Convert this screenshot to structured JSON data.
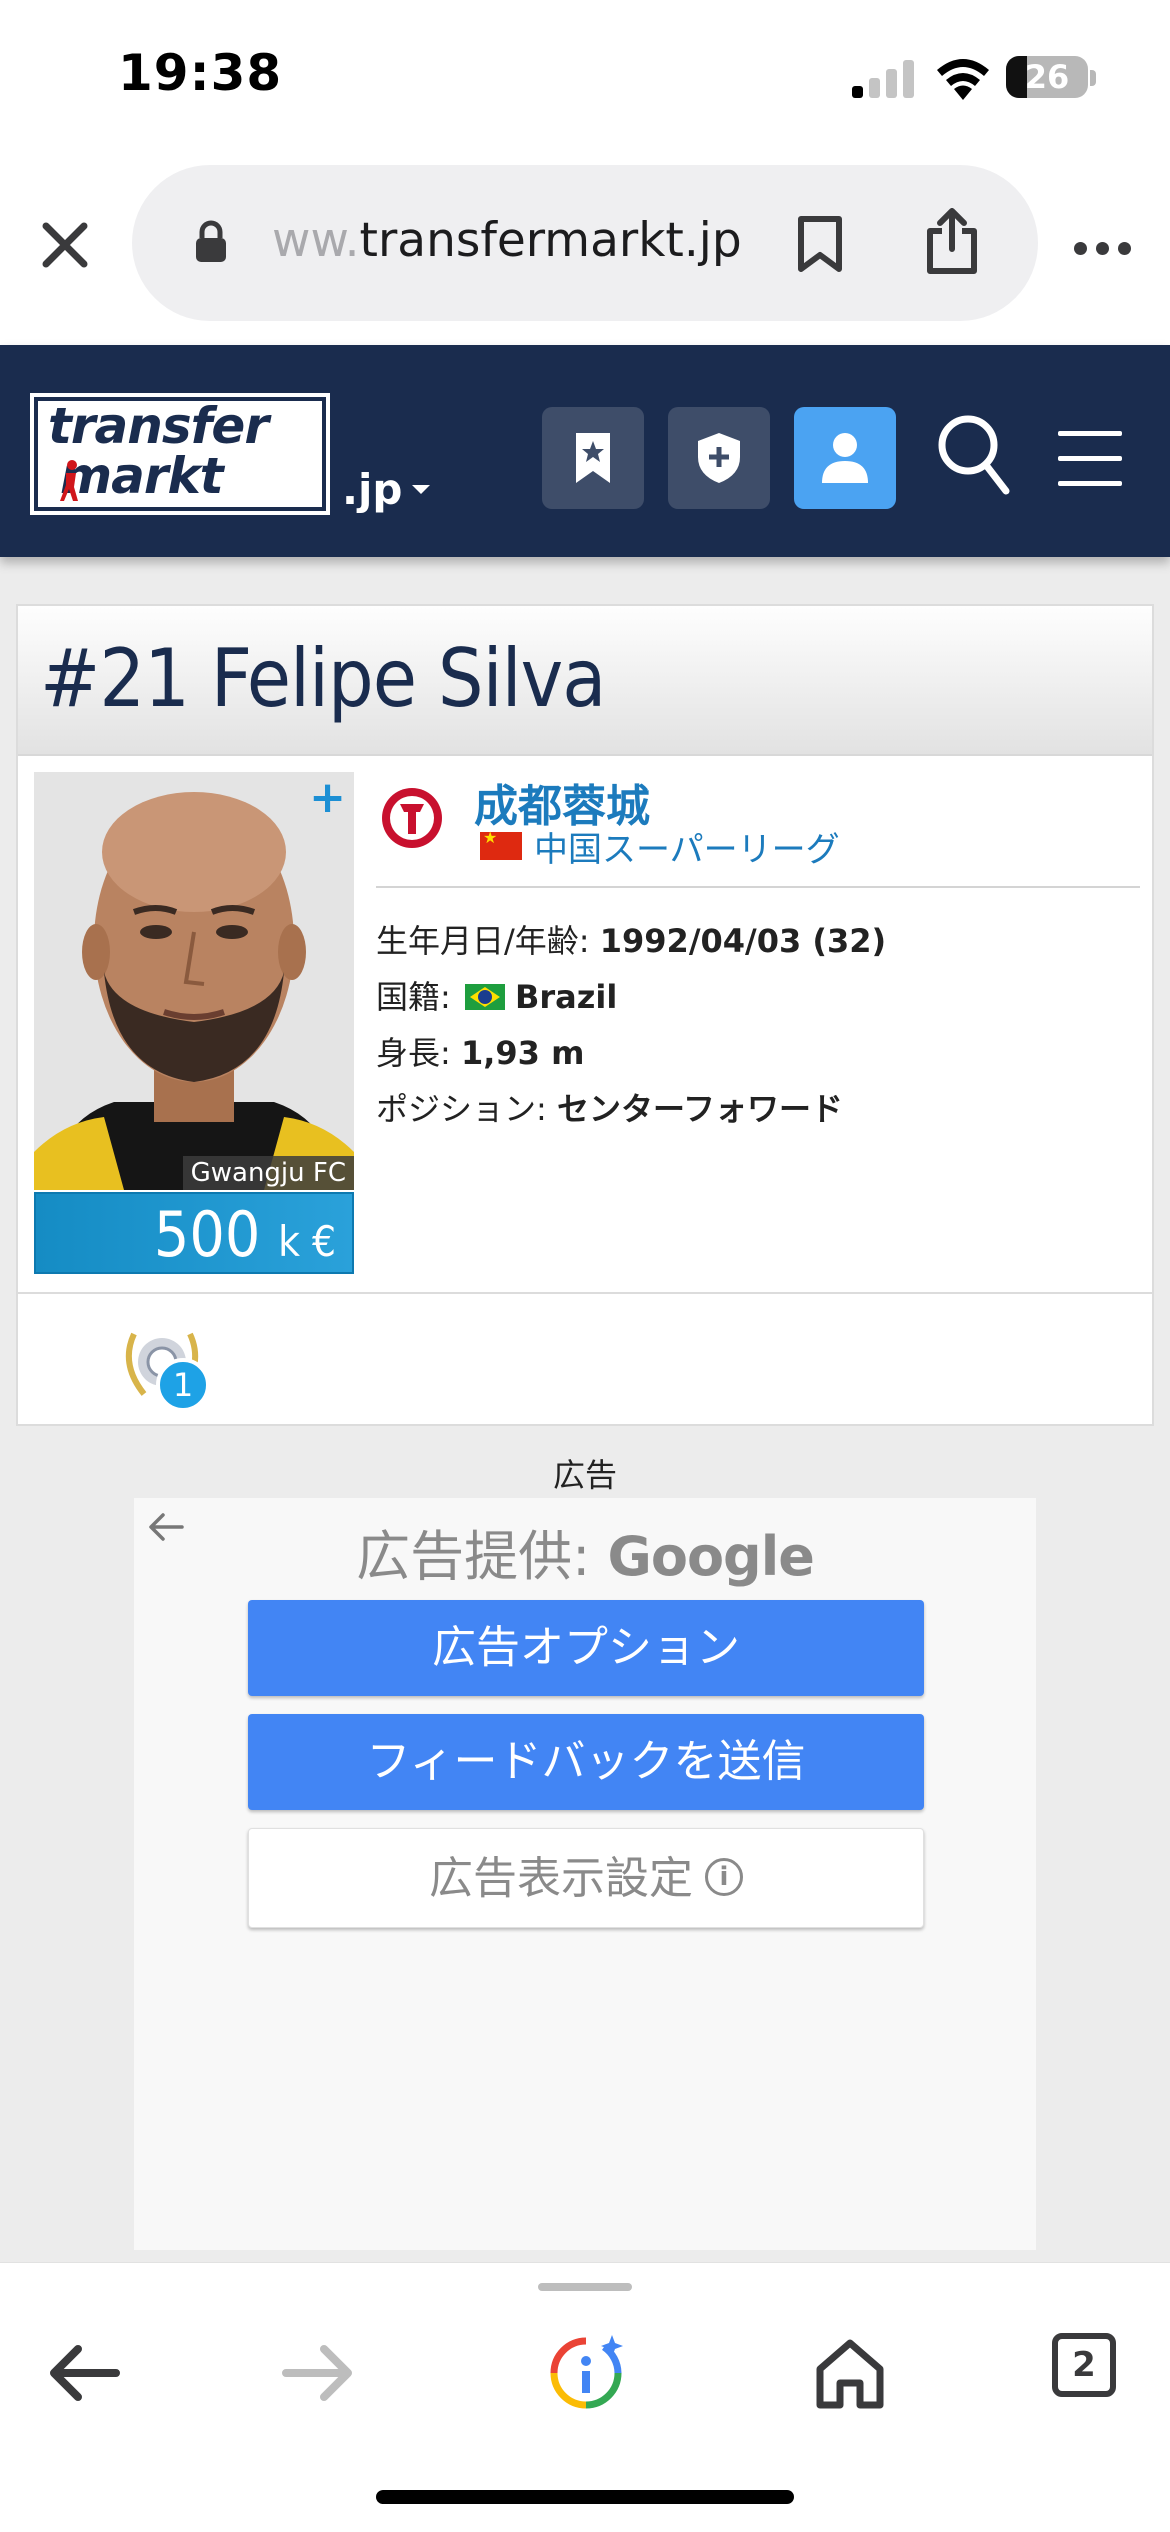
{
  "status_bar": {
    "time": "19:38",
    "battery": "26"
  },
  "browser": {
    "url_faded": "ww.",
    "url_main": "transfermarkt.jp",
    "tab_count": "2"
  },
  "site_header": {
    "logo_line1": "transfer",
    "logo_line2": "markt",
    "domain_selector": ".jp",
    "buttons": [
      "bookmark-icon",
      "shield-plus-icon",
      "user-icon",
      "search-icon",
      "menu-icon"
    ]
  },
  "player": {
    "title": "#21 Felipe Silva",
    "photo_club_tag": "Gwangju FC",
    "market_value_number": "500",
    "market_value_unit": "k €",
    "club": "成都蓉城",
    "league": "中国スーパーリーグ",
    "dob_label": "生年月日/年齢:",
    "dob_value": "1992/04/03 (32)",
    "nationality_label": "国籍:",
    "nationality_value": "Brazil",
    "height_label": "身長:",
    "height_value": "1,93 m",
    "position_label": "ポジション:",
    "position_value": "センターフォワード",
    "award_count": "1"
  },
  "ad": {
    "label": "広告",
    "provided_prefix": "広告提供:",
    "provided_brand": "Google",
    "options_button": "広告オプション",
    "feedback_button": "フィードバックを送信",
    "settings_button": "広告表示設定"
  },
  "colors": {
    "header_bg": "#1a2c4e",
    "link_blue": "#1c7bbd",
    "market_value_bg": "#158cc4",
    "google_blue": "#4285f4",
    "user_button": "#4ba3f2"
  }
}
